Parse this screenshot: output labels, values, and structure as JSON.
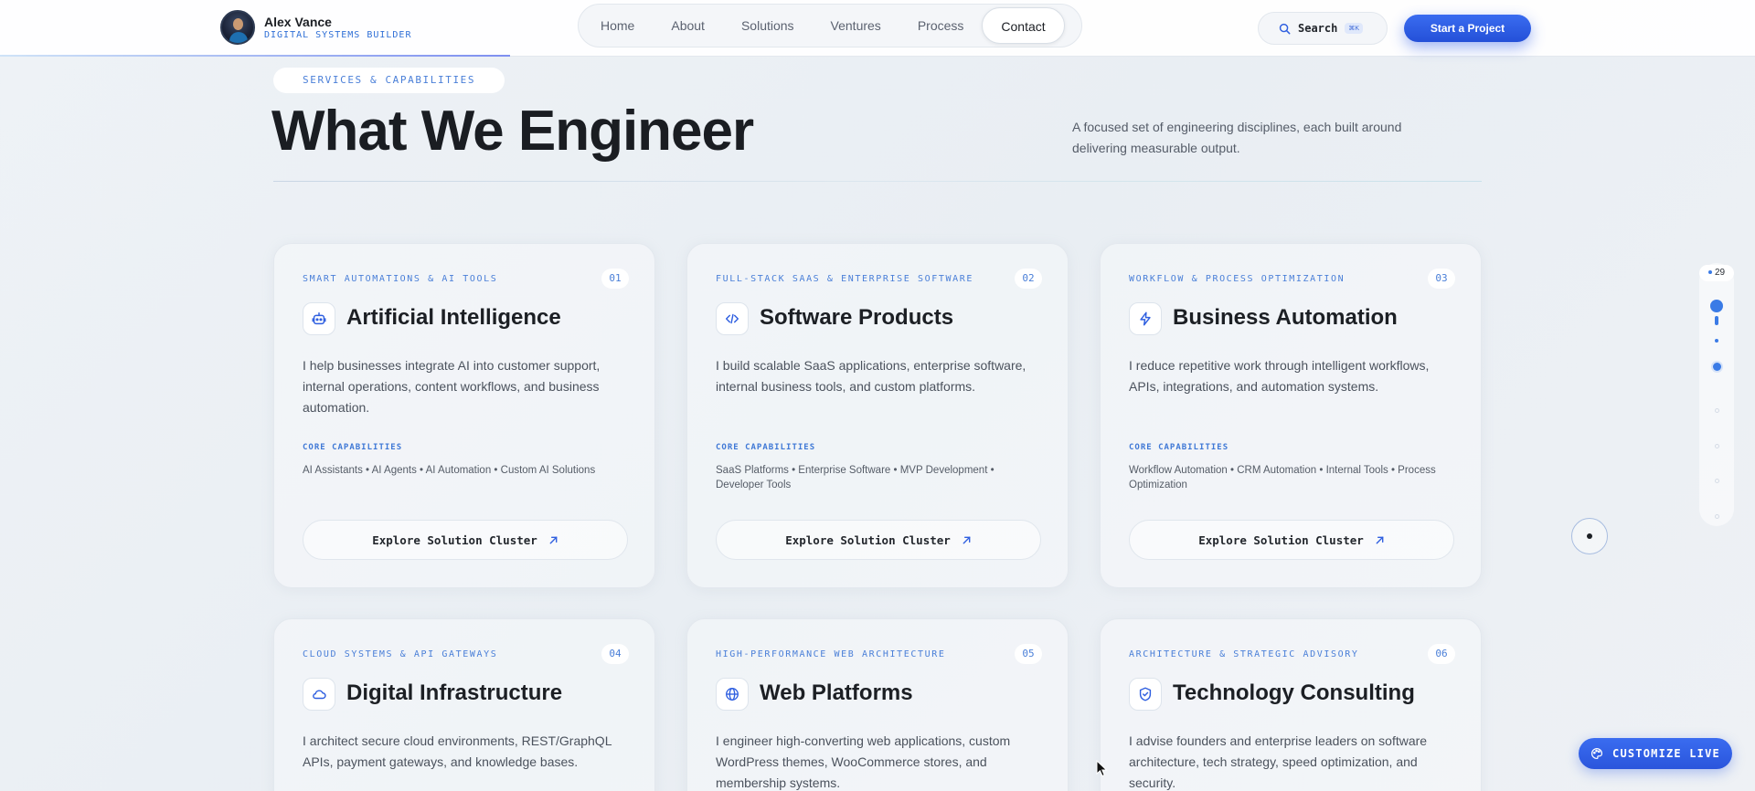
{
  "brand": {
    "name": "Alex Vance",
    "subtitle": "DIGITAL SYSTEMS BUILDER"
  },
  "nav": {
    "items": [
      {
        "label": "Home"
      },
      {
        "label": "About"
      },
      {
        "label": "Solutions"
      },
      {
        "label": "Ventures"
      },
      {
        "label": "Process"
      },
      {
        "label": "Contact",
        "active": true
      }
    ]
  },
  "search": {
    "label": "Search",
    "shortcut": "⌘K"
  },
  "cta": {
    "label": "Start a Project"
  },
  "section": {
    "chip": "SERVICES & CAPABILITIES",
    "title": "What We Engineer",
    "description": "A focused set of engineering disciplines, each built around delivering measurable output."
  },
  "cards": [
    {
      "eyebrow": "SMART AUTOMATIONS & AI TOOLS",
      "number": "01",
      "icon": "robot-icon",
      "title": "Artificial Intelligence",
      "body": "I help businesses integrate AI into customer support, internal operations, content workflows, and business automation.",
      "cap_label": "CORE CAPABILITIES",
      "capabilities": "AI Assistants • AI Agents • AI Automation • Custom AI Solutions",
      "explore": "Explore Solution Cluster"
    },
    {
      "eyebrow": "FULL-STACK SAAS & ENTERPRISE SOFTWARE",
      "number": "02",
      "icon": "code-icon",
      "title": "Software Products",
      "body": "I build scalable SaaS applications, enterprise software, internal business tools, and custom platforms.",
      "cap_label": "CORE CAPABILITIES",
      "capabilities": "SaaS Platforms • Enterprise Software • MVP Development • Developer Tools",
      "explore": "Explore Solution Cluster"
    },
    {
      "eyebrow": "WORKFLOW & PROCESS OPTIMIZATION",
      "number": "03",
      "icon": "lightning-icon",
      "title": "Business Automation",
      "body": "I reduce repetitive work through intelligent workflows, APIs, integrations, and automation systems.",
      "cap_label": "CORE CAPABILITIES",
      "capabilities": "Workflow Automation • CRM Automation • Internal Tools • Process Optimization",
      "explore": "Explore Solution Cluster"
    },
    {
      "eyebrow": "CLOUD SYSTEMS & API GATEWAYS",
      "number": "04",
      "icon": "cloud-icon",
      "title": "Digital Infrastructure",
      "body": "I architect secure cloud environments, REST/GraphQL APIs, payment gateways, and knowledge bases."
    },
    {
      "eyebrow": "HIGH-PERFORMANCE WEB ARCHITECTURE",
      "number": "05",
      "icon": "globe-icon",
      "title": "Web Platforms",
      "body": "I engineer high-converting web applications, custom WordPress themes, WooCommerce stores, and membership systems."
    },
    {
      "eyebrow": "ARCHITECTURE & STRATEGIC ADVISORY",
      "number": "06",
      "icon": "shield-icon",
      "title": "Technology Consulting",
      "body": "I advise founders and enterprise leaders on software architecture, tech strategy, speed optimization, and security."
    }
  ],
  "rail": {
    "count": "29"
  },
  "customize": {
    "label": "CUSTOMIZE LIVE"
  },
  "colors": {
    "accent": "#2f5fe0",
    "accent_text": "#4a7fd8",
    "text": "#1c1f24"
  }
}
